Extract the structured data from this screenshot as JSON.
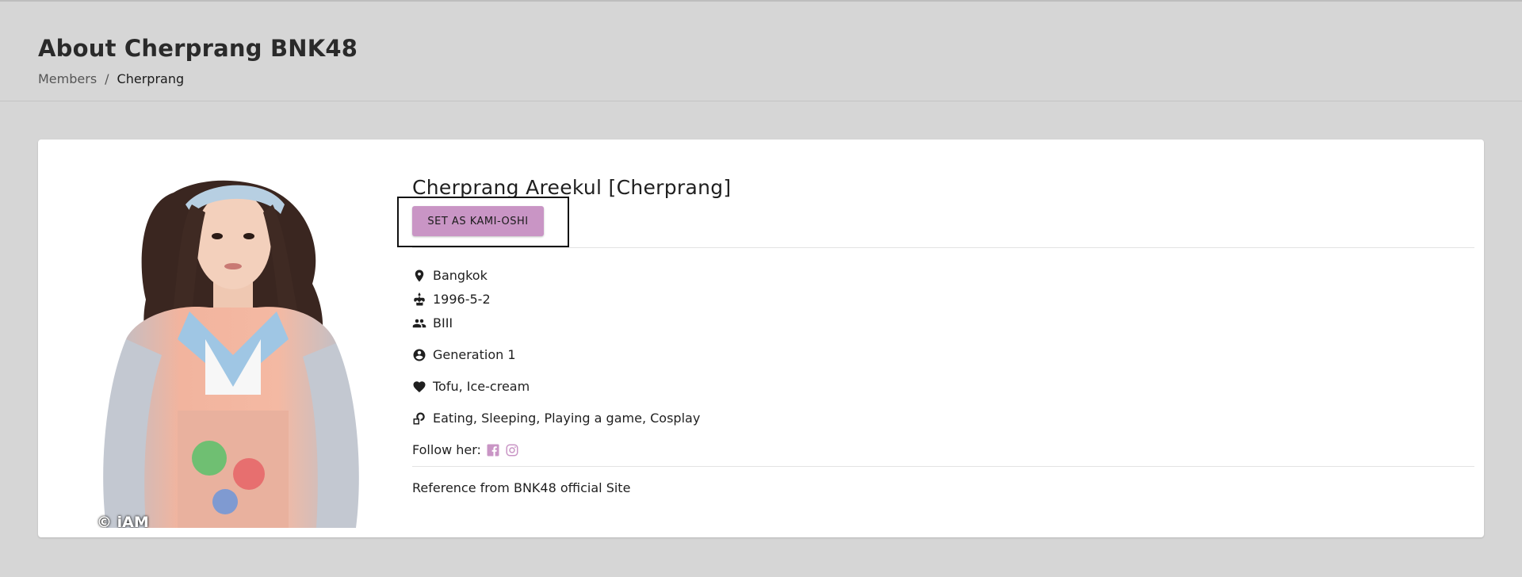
{
  "header": {
    "title": "About Cherprang BNK48",
    "breadcrumb": {
      "parent": "Members",
      "separator": "/",
      "current": "Cherprang"
    }
  },
  "profile": {
    "photo_credit": "© iAM",
    "name": "Cherprang Areekul [Cherprang]",
    "kami_button_label": "SET AS KAMI-OSHI",
    "details": {
      "hometown": "Bangkok",
      "birthday": "1996-5-2",
      "team": "BIII",
      "generation": "Generation 1",
      "favorites": "Tofu, Ice-cream",
      "hobbies": "Eating, Sleeping, Playing a game, Cosplay"
    },
    "follow_label": "Follow her:",
    "social": [
      "facebook-icon",
      "instagram-icon"
    ],
    "reference": "Reference from BNK48 official Site"
  },
  "colors": {
    "background": "#d6d6d6",
    "card": "#ffffff",
    "accent": "#c995c5"
  }
}
